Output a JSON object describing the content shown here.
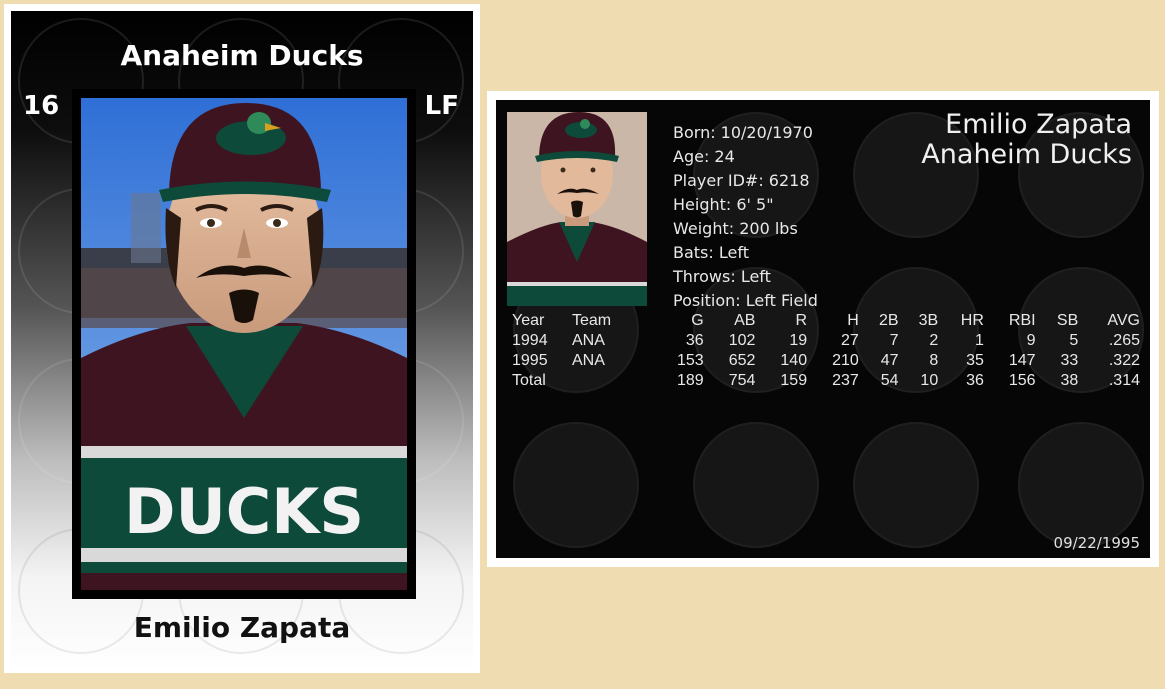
{
  "front": {
    "team": "Anaheim Ducks",
    "number": "16",
    "position": "LF",
    "name": "Emilio Zapata",
    "jersey_text": "DUCKS"
  },
  "back": {
    "name": "Emilio Zapata",
    "team": "Anaheim Ducks",
    "bio": [
      "Born: 10/20/1970",
      "Age: 24",
      "Player ID#: 6218",
      "Height: 6' 5\"",
      "Weight: 200 lbs",
      "Bats: Left",
      "Throws: Left",
      "Position: Left Field"
    ],
    "stats": {
      "headers": [
        "Year",
        "Team",
        "G",
        "AB",
        "R",
        "H",
        "2B",
        "3B",
        "HR",
        "RBI",
        "SB",
        "AVG"
      ],
      "rows": [
        [
          "1994",
          "ANA",
          "36",
          "102",
          "19",
          "27",
          "7",
          "2",
          "1",
          "9",
          "5",
          ".265"
        ],
        [
          "1995",
          "ANA",
          "153",
          "652",
          "140",
          "210",
          "47",
          "8",
          "35",
          "147",
          "33",
          ".322"
        ],
        [
          "Total",
          "",
          "189",
          "754",
          "159",
          "237",
          "54",
          "10",
          "36",
          "156",
          "38",
          ".314"
        ]
      ]
    },
    "date": "09/22/1995"
  },
  "colors": {
    "background": "#efdcb0",
    "jersey_maroon": "#3e1420",
    "jersey_green": "#0d4a3a",
    "sky_blue": "#3a78d8"
  }
}
